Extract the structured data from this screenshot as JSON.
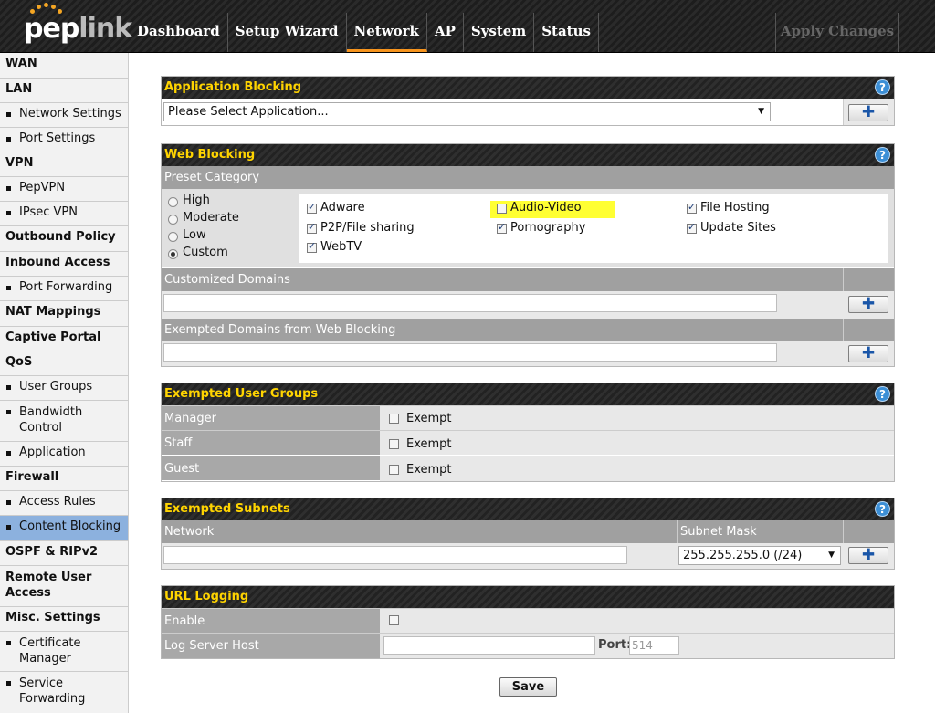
{
  "brand": {
    "name_a": "pep",
    "name_b": "link"
  },
  "nav": {
    "tabs": [
      "Dashboard",
      "Setup Wizard",
      "Network",
      "AP",
      "System",
      "Status"
    ],
    "active": "Network",
    "apply_label": "Apply Changes"
  },
  "sidebar": [
    {
      "label": "WAN",
      "type": "head"
    },
    {
      "label": "LAN",
      "type": "head"
    },
    {
      "label": "Network Settings",
      "type": "item"
    },
    {
      "label": "Port Settings",
      "type": "item"
    },
    {
      "label": "VPN",
      "type": "head"
    },
    {
      "label": "PepVPN",
      "type": "item"
    },
    {
      "label": "IPsec VPN",
      "type": "item"
    },
    {
      "label": "Outbound Policy",
      "type": "head"
    },
    {
      "label": "Inbound Access",
      "type": "head"
    },
    {
      "label": "Port Forwarding",
      "type": "item"
    },
    {
      "label": "NAT Mappings",
      "type": "head"
    },
    {
      "label": "Captive Portal",
      "type": "head"
    },
    {
      "label": "QoS",
      "type": "head"
    },
    {
      "label": "User Groups",
      "type": "item"
    },
    {
      "label": "Bandwidth Control",
      "type": "item"
    },
    {
      "label": "Application",
      "type": "item"
    },
    {
      "label": "Firewall",
      "type": "head"
    },
    {
      "label": "Access Rules",
      "type": "item"
    },
    {
      "label": "Content Blocking",
      "type": "item",
      "selected": true
    },
    {
      "label": "OSPF & RIPv2",
      "type": "head"
    },
    {
      "label": "Remote User Access",
      "type": "head"
    },
    {
      "label": "Misc. Settings",
      "type": "head"
    },
    {
      "label": "Certificate Manager",
      "type": "item"
    },
    {
      "label": "Service Forwarding",
      "type": "item"
    }
  ],
  "app_blocking": {
    "title": "Application Blocking",
    "select_value": "Please Select Application...",
    "help": "?"
  },
  "web_blocking": {
    "title": "Web Blocking",
    "help": "?",
    "preset_label": "Preset Category",
    "presets": [
      {
        "label": "High",
        "checked": false
      },
      {
        "label": "Moderate",
        "checked": false
      },
      {
        "label": "Low",
        "checked": false
      },
      {
        "label": "Custom",
        "checked": true
      }
    ],
    "categories": [
      {
        "label": "Adware",
        "checked": true
      },
      {
        "label": "Audio-Video",
        "checked": false
      },
      {
        "label": "File Hosting",
        "checked": true
      },
      {
        "label": "P2P/File sharing",
        "checked": true
      },
      {
        "label": "Pornography",
        "checked": true
      },
      {
        "label": "Update Sites",
        "checked": true
      },
      {
        "label": "WebTV",
        "checked": true
      }
    ],
    "custom_domains_label": "Customized Domains",
    "exempted_domains_label": "Exempted Domains from Web Blocking"
  },
  "user_groups": {
    "title": "Exempted User Groups",
    "help": "?",
    "rows": [
      {
        "label": "Manager",
        "option": "Exempt",
        "checked": false
      },
      {
        "label": "Staff",
        "option": "Exempt",
        "checked": false
      },
      {
        "label": "Guest",
        "option": "Exempt",
        "checked": false
      }
    ]
  },
  "subnets": {
    "title": "Exempted Subnets",
    "help": "?",
    "col_network": "Network",
    "col_mask": "Subnet Mask",
    "mask_value": "255.255.255.0 (/24)"
  },
  "url_logging": {
    "title": "URL Logging",
    "enable_label": "Enable",
    "enable_checked": false,
    "host_label": "Log Server Host",
    "port_label": "Port:",
    "port_placeholder": "514"
  },
  "save_label": "Save"
}
